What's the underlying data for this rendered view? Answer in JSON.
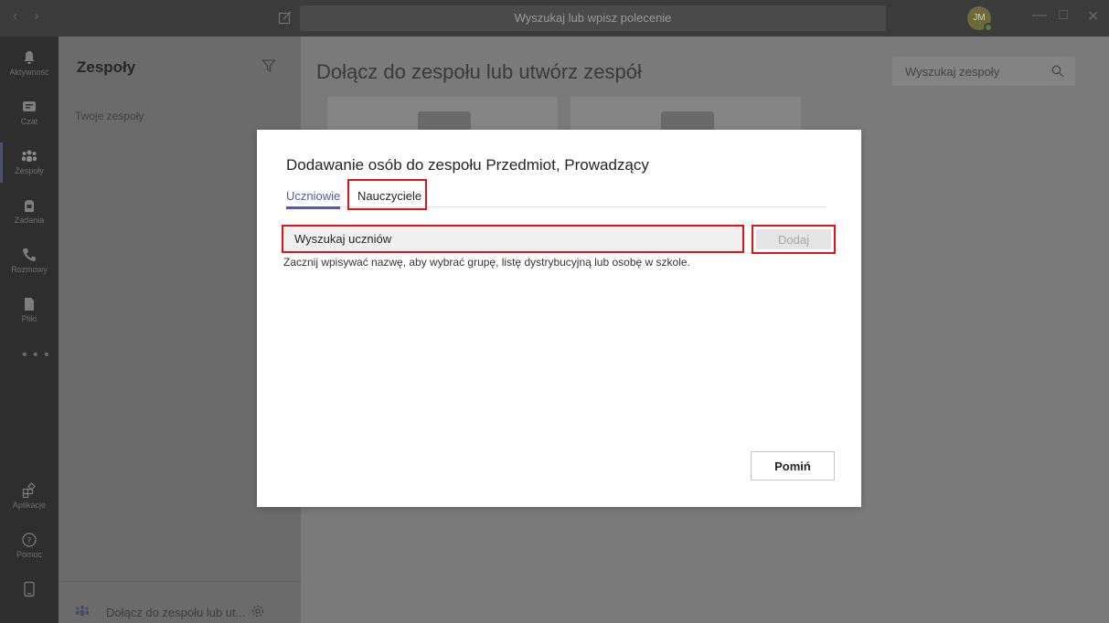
{
  "titlebar": {
    "search_placeholder": "Wyszukaj lub wpisz polecenie",
    "avatar_initials": "JM"
  },
  "rail": {
    "items": [
      {
        "label": "Aktywność",
        "icon": "bell-icon"
      },
      {
        "label": "Czat",
        "icon": "chat-icon"
      },
      {
        "label": "Zespoły",
        "icon": "teams-icon"
      },
      {
        "label": "Zadania",
        "icon": "assignments-icon"
      },
      {
        "label": "Rozmowy",
        "icon": "phone-icon"
      },
      {
        "label": "Pliki",
        "icon": "files-icon"
      },
      {
        "label": "Aplikacje",
        "icon": "apps-icon"
      },
      {
        "label": "Pomoc",
        "icon": "help-icon"
      }
    ],
    "more": "• • •"
  },
  "left_panel": {
    "title": "Zespoły",
    "subtitle": "Twoje zespoły",
    "footer_label": "Dołącz do zespołu lub ut..."
  },
  "main": {
    "title": "Dołącz do zespołu lub utwórz zespół",
    "team_search_placeholder": "Wyszukaj zespoły"
  },
  "dialog": {
    "title": "Dodawanie osób do zespołu Przedmiot, Prowadzący",
    "tabs": [
      {
        "label": "Uczniowie",
        "active": true
      },
      {
        "label": "Nauczyciele",
        "active": false
      }
    ],
    "search_placeholder": "Wyszukaj uczniów",
    "add_label": "Dodaj",
    "hint": "Zacznij wpisywać nazwę, aby wybrać grupę, listę dystrybucyjną lub osobę w szkole.",
    "skip_label": "Pomiń"
  },
  "colors": {
    "accent": "#5558af",
    "highlight": "#e0151c"
  }
}
